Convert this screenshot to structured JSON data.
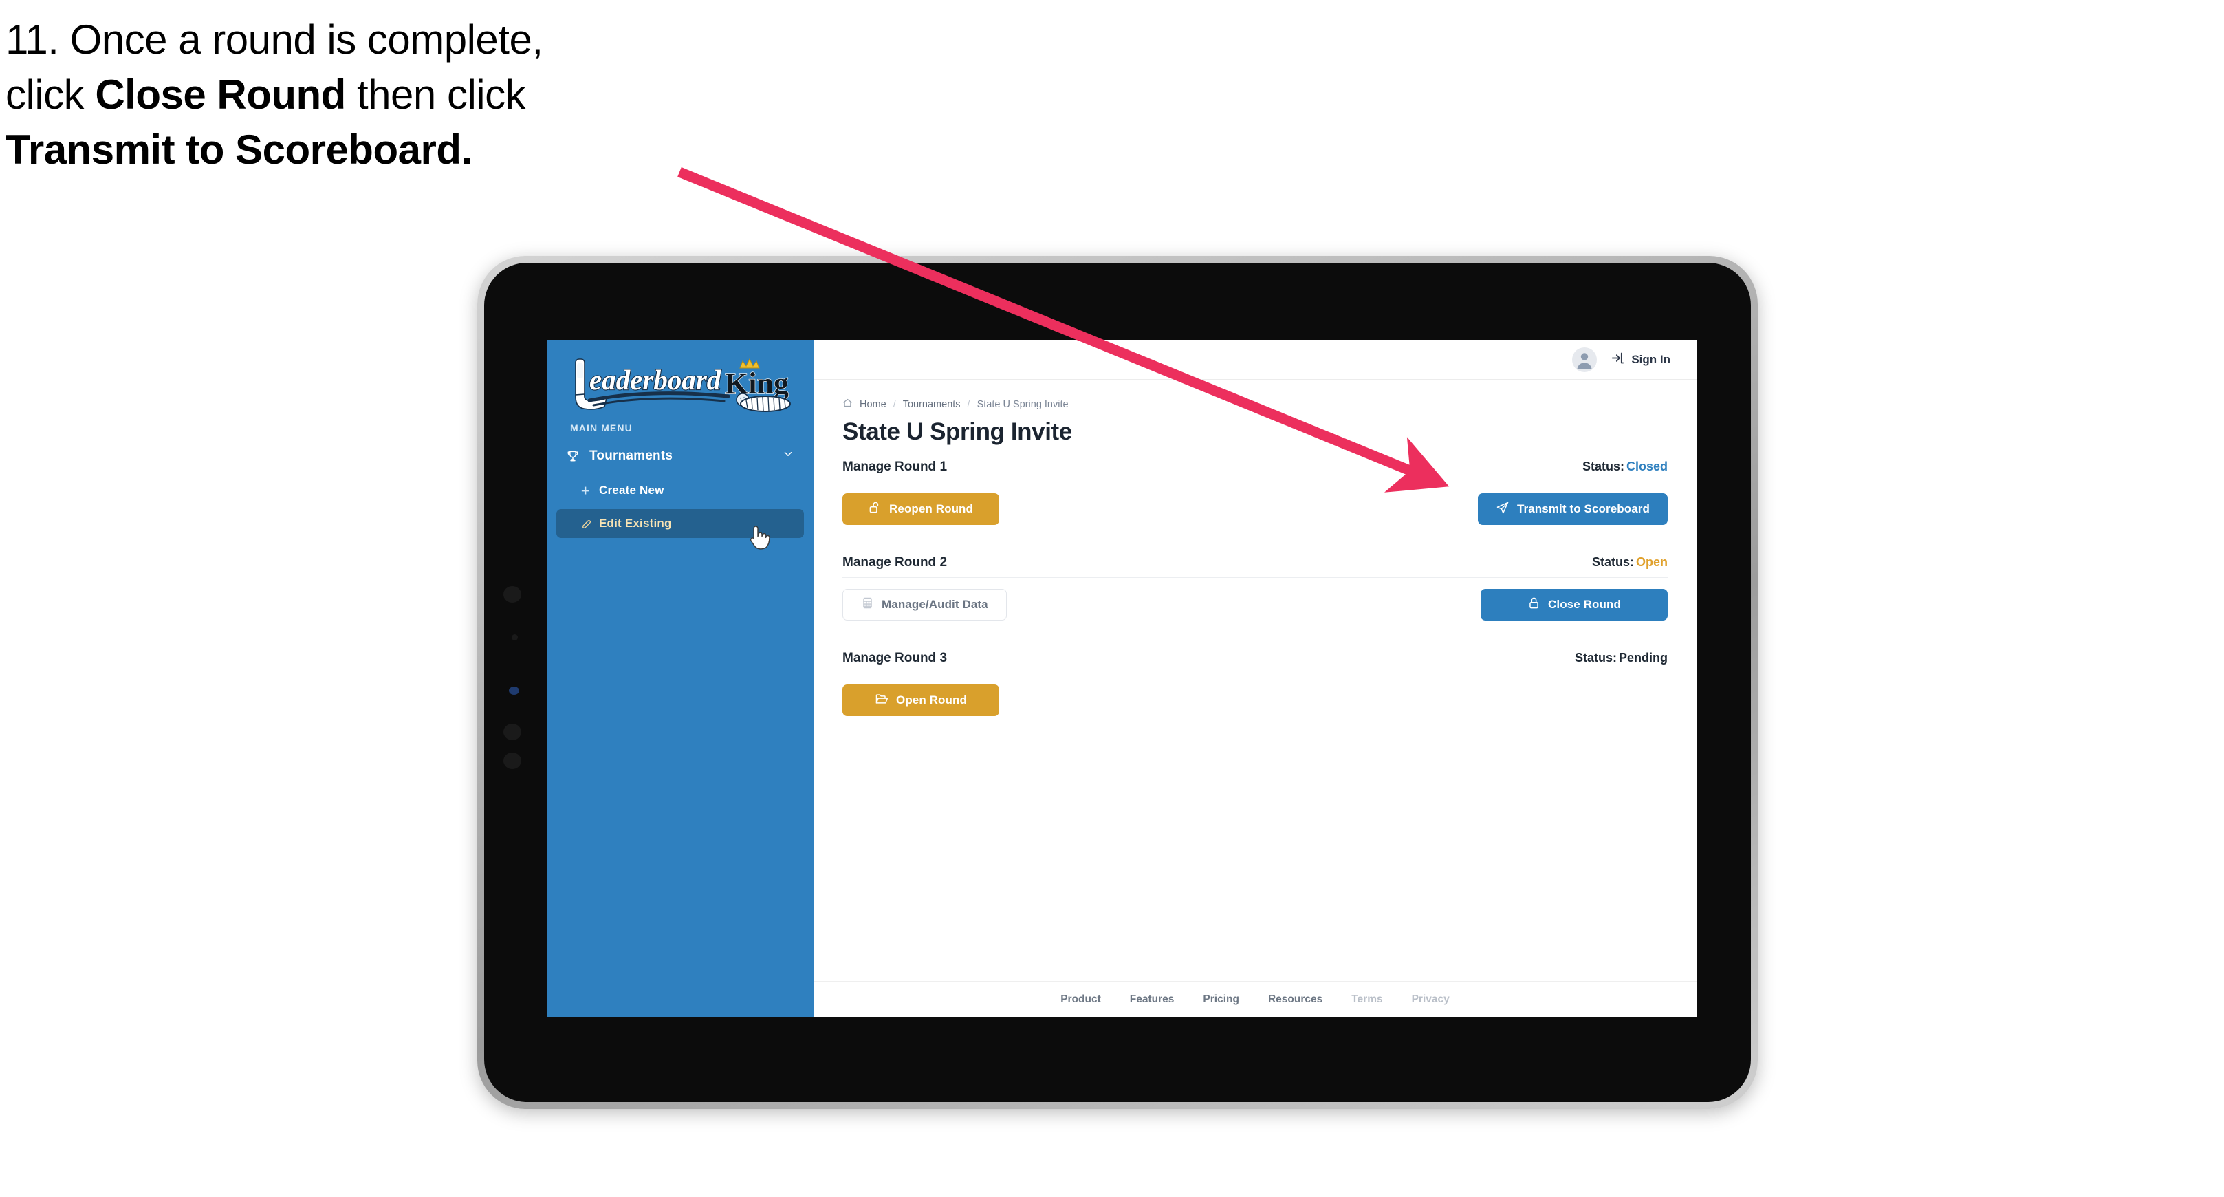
{
  "caption": {
    "line1": "11. Once a round is complete,",
    "line2_pre": "click ",
    "line2_bold": "Close Round",
    "line2_post": " then click",
    "line3_bold": "Transmit to Scoreboard."
  },
  "annotation": {
    "arrow_color": "#ec2f5d",
    "arrow_name": "callout-arrow",
    "points_to": "Transmit to Scoreboard"
  },
  "app": {
    "brand": {
      "name_part1": "Leaderboard",
      "name_part2": "King",
      "icon": "golf-club-icon",
      "crown_icon": "crown-icon"
    },
    "sidebar": {
      "section_label": "MAIN MENU",
      "bg_color": "#2f80bf",
      "items": [
        {
          "label": "Tournaments",
          "icon": "trophy-icon",
          "chevron": "chevron-down-icon",
          "active": false
        },
        {
          "label": "Create New",
          "icon": "plus-icon",
          "active": false
        },
        {
          "label": "Edit Existing",
          "icon": "edit-pencil-icon",
          "active": true
        }
      ]
    },
    "topbar": {
      "avatar_icon": "user-avatar-icon",
      "signin_icon": "sign-in-arrow-icon",
      "signin_label": "Sign In"
    },
    "breadcrumb": {
      "home_icon": "home-icon",
      "items": [
        "Home",
        "Tournaments",
        "State U Spring Invite"
      ],
      "separator": "/"
    },
    "page_title": "State U Spring Invite",
    "rounds": [
      {
        "name": "Manage Round 1",
        "status_label": "Status:",
        "status_value": "Closed",
        "status_color": "#2f80bf",
        "left_button": {
          "label": "Reopen Round",
          "icon": "unlock-icon",
          "style": "gold"
        },
        "right_button": {
          "label": "Transmit to Scoreboard",
          "icon": "paper-plane-icon",
          "style": "blue"
        }
      },
      {
        "name": "Manage Round 2",
        "status_label": "Status:",
        "status_value": "Open",
        "status_color": "#e0a12c",
        "left_button": {
          "label": "Manage/Audit Data",
          "icon": "table-grid-icon",
          "style": "ghost"
        },
        "right_button": {
          "label": "Close Round",
          "icon": "lock-icon",
          "style": "blue"
        }
      },
      {
        "name": "Manage Round 3",
        "status_label": "Status:",
        "status_value": "Pending",
        "status_color": "#1e2833",
        "left_button": {
          "label": "Open Round",
          "icon": "open-folder-icon",
          "style": "gold"
        },
        "right_button": null
      }
    ],
    "footer": {
      "links": [
        "Product",
        "Features",
        "Pricing",
        "Resources",
        "Terms",
        "Privacy"
      ]
    }
  },
  "device": {
    "type": "tablet",
    "frame_color": "#b9b9b9",
    "bezel_color": "#0c0c0c"
  },
  "cursor": {
    "type": "pointing-hand-cursor"
  }
}
